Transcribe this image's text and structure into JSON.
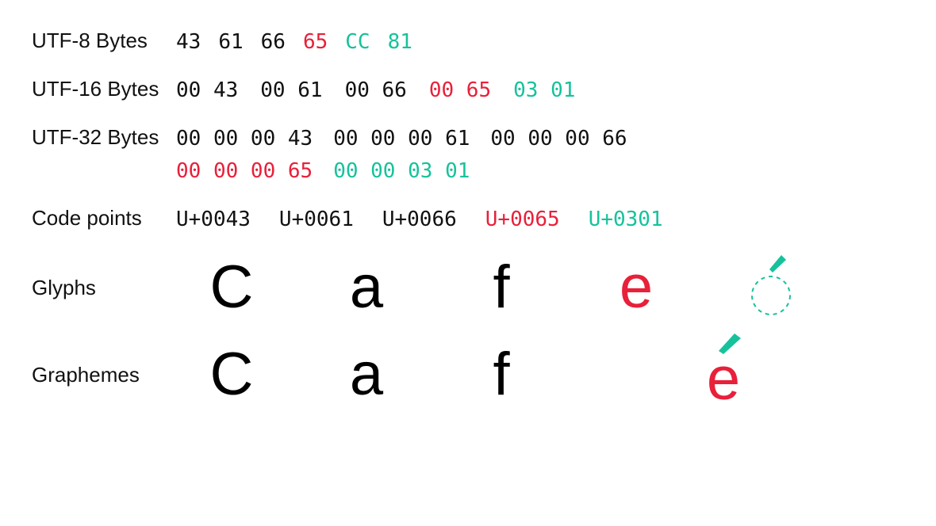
{
  "labels": {
    "utf8": "UTF-8 Bytes",
    "utf16": "UTF-16 Bytes",
    "utf32": "UTF-32 Bytes",
    "codepoints": "Code points",
    "glyphs": "Glyphs",
    "graphemes": "Graphemes"
  },
  "utf8": [
    {
      "v": "43",
      "c": "black"
    },
    {
      "v": "61",
      "c": "black"
    },
    {
      "v": "66",
      "c": "black"
    },
    {
      "v": "65",
      "c": "red"
    },
    {
      "v": "CC",
      "c": "teal"
    },
    {
      "v": "81",
      "c": "teal"
    }
  ],
  "utf16": [
    {
      "v": "00 43",
      "c": "black"
    },
    {
      "v": "00 61",
      "c": "black"
    },
    {
      "v": "00 66",
      "c": "black"
    },
    {
      "v": "00 65",
      "c": "red"
    },
    {
      "v": "03 01",
      "c": "teal"
    }
  ],
  "utf32_line1": [
    {
      "v": "00 00 00 43",
      "c": "black"
    },
    {
      "v": "00 00 00 61",
      "c": "black"
    },
    {
      "v": "00 00 00 66",
      "c": "black"
    }
  ],
  "utf32_line2": [
    {
      "v": "00 00 00 65",
      "c": "red"
    },
    {
      "v": "00 00 03 01",
      "c": "teal"
    }
  ],
  "codepoints": [
    {
      "v": "U+0043",
      "c": "black"
    },
    {
      "v": "U+0061",
      "c": "black"
    },
    {
      "v": "U+0066",
      "c": "black"
    },
    {
      "v": "U+0065",
      "c": "red"
    },
    {
      "v": "U+0301",
      "c": "teal"
    }
  ],
  "glyphs": {
    "c": "C",
    "a": "a",
    "f": "f",
    "e": "e"
  },
  "graphemes": {
    "c": "C",
    "a": "a",
    "f": "f",
    "e": "e"
  },
  "colors": {
    "black": "#111111",
    "red": "#E8203A",
    "teal": "#16C29B"
  }
}
